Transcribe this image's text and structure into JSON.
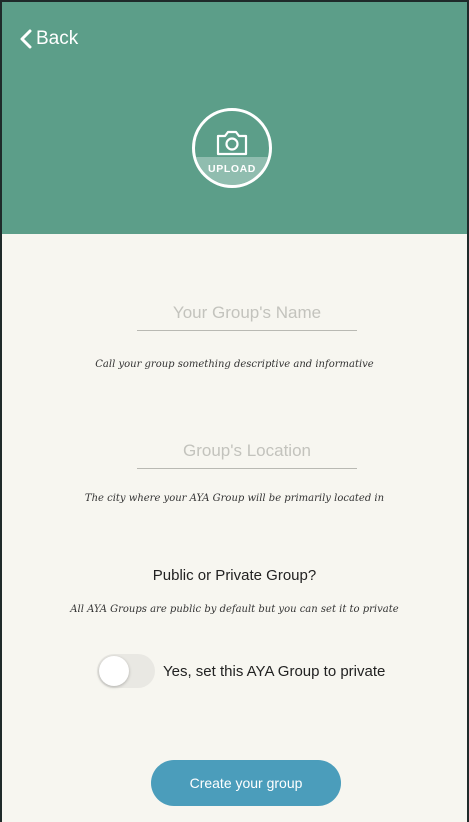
{
  "header": {
    "back_label": "Back",
    "upload_label": "UPLOAD",
    "background_color": "#5c9e89"
  },
  "form": {
    "name_field": {
      "placeholder": "Your Group's Name",
      "value": "",
      "hint": "Call your group something descriptive and informative"
    },
    "location_field": {
      "placeholder": "Group's Location",
      "value": "",
      "hint": "The city where your AYA Group will be primarily located in"
    },
    "privacy": {
      "title": "Public or Private Group?",
      "hint": "All AYA Groups are public by default but you can set it to private",
      "toggle_label": "Yes, set this AYA Group to private",
      "toggle_on": false
    },
    "submit_label": "Create your group",
    "submit_color": "#4b9dbb"
  },
  "icons": {
    "back": "chevron-left-icon",
    "upload": "camera-icon"
  }
}
